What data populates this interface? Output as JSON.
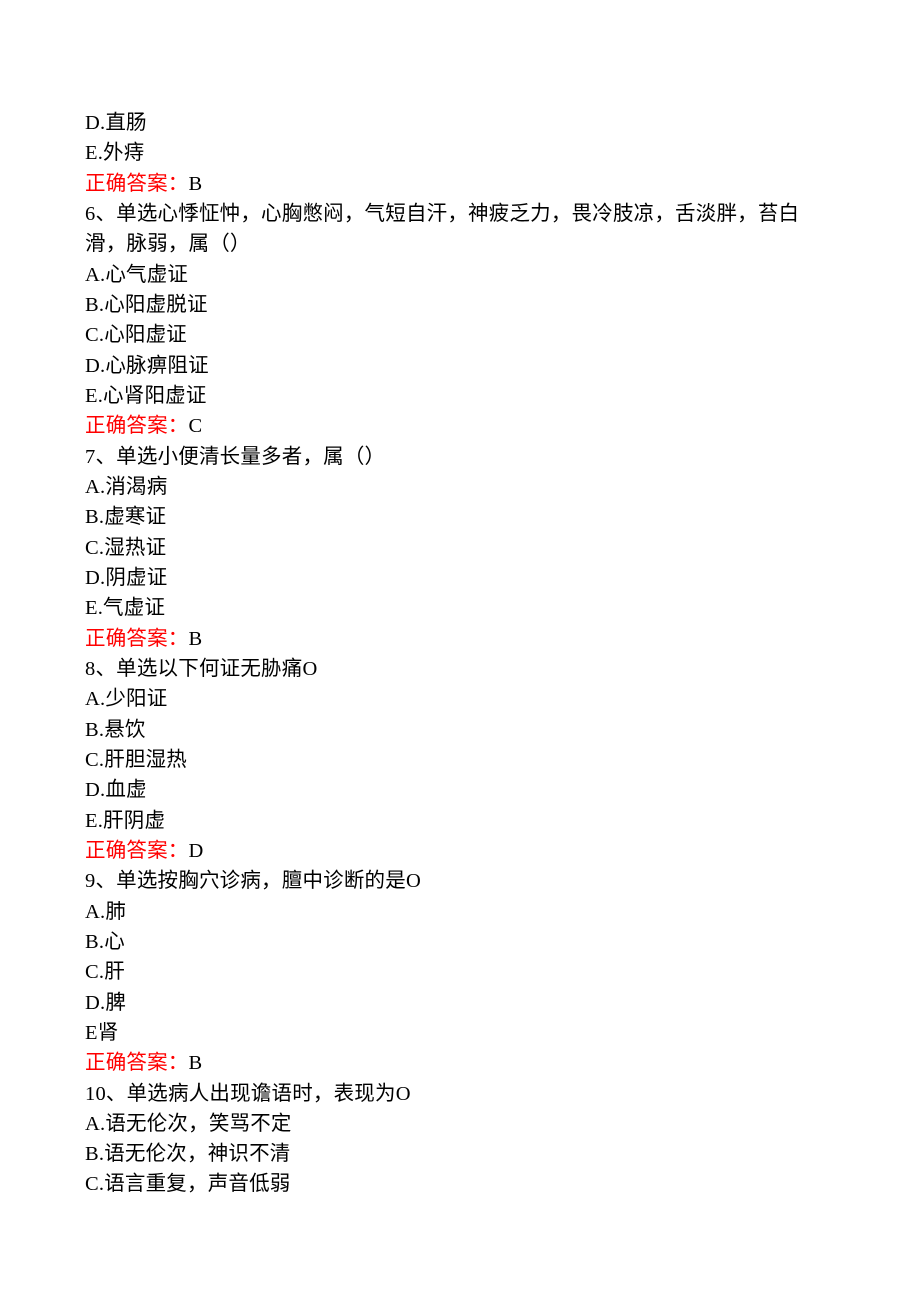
{
  "q5": {
    "option_d": "D.直肠",
    "option_e": "E.外痔",
    "answer_label": "正确答案：",
    "answer_value": "B"
  },
  "q6": {
    "stem": "6、单选心悸怔忡，心胸憋闷，气短自汗，神疲乏力，畏冷肢凉，舌淡胖，苔白滑，脉弱，属（）",
    "option_a": "A.心气虚证",
    "option_b": "B.心阳虚脱证",
    "option_c": "C.心阳虚证",
    "option_d": "D.心脉痹阻证",
    "option_e": "E.心肾阳虚证",
    "answer_label": "正确答案：",
    "answer_value": "C"
  },
  "q7": {
    "stem": "7、单选小便清长量多者，属（）",
    "option_a": "A.消渴病",
    "option_b": "B.虚寒证",
    "option_c": "C.湿热证",
    "option_d": "D.阴虚证",
    "option_e": "E.气虚证",
    "answer_label": "正确答案：",
    "answer_value": "B"
  },
  "q8": {
    "stem": "8、单选以下何证无胁痛O",
    "option_a": "A.少阳证",
    "option_b": "B.悬饮",
    "option_c": "C.肝胆湿热",
    "option_d": "D.血虚",
    "option_e": "E.肝阴虚",
    "answer_label": "正确答案：",
    "answer_value": "D"
  },
  "q9": {
    "stem": "9、单选按胸穴诊病，膻中诊断的是O",
    "option_a": "A.肺",
    "option_b": "B.心",
    "option_c": "C.肝",
    "option_d": "D.脾",
    "option_e": "E肾",
    "answer_label": "正确答案：",
    "answer_value": "B"
  },
  "q10": {
    "stem": "10、单选病人出现谵语时，表现为O",
    "option_a": "A.语无伦次，笑骂不定",
    "option_b": "B.语无伦次，神识不清",
    "option_c": "C.语言重复，声音低弱"
  }
}
